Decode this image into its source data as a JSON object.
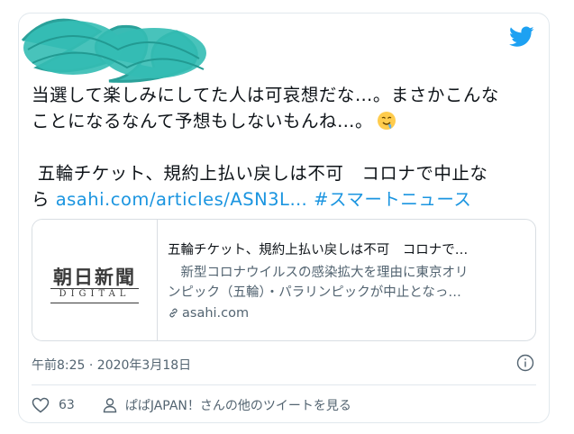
{
  "tweet": {
    "line1": "当選して楽しみにしてた人は可哀想だな…。まさかこんな",
    "line2": "ことになるなんて予想もしないもんね…。",
    "line3": " 五輪チケット、規約上払い戻しは不可　コロナで中止な",
    "line4_prefix": "ら ",
    "url": "asahi.com/articles/ASN3L…",
    "hashtag": "#スマートニュース",
    "emoji": "drooling-face-emoji"
  },
  "preview": {
    "logo_main": "朝日新聞",
    "logo_sub": "DIGITAL",
    "title": "五輪チケット、規約上払い戻しは不可　コロナで…",
    "desc_line1": "　新型コロナウイルスの感染拡大を理由に東京オリ",
    "desc_line2": "ンピック（五輪）・パラリンピックが中止となっ…",
    "domain": "asahi.com"
  },
  "meta": {
    "timestamp": "午前8:25 · 2020年3月18日"
  },
  "actions": {
    "likes": "63",
    "user_link": "ぱぱJAPAN！さんの他のツイートを見る"
  },
  "colors": {
    "link": "#1b95e0",
    "twitter_blue": "#1da1f2",
    "scribble": "#2fb8b0"
  }
}
